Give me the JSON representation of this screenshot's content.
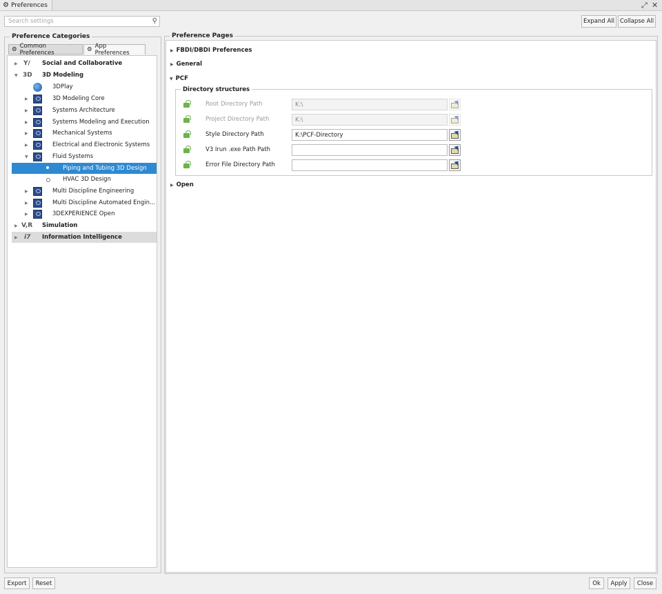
{
  "window": {
    "title": "Preferences"
  },
  "search": {
    "placeholder": "Search settings"
  },
  "toolbar": {
    "expand_all": "Expand All",
    "collapse_all": "Collapse All"
  },
  "categories": {
    "title": "Preference Categories",
    "tabs": [
      {
        "label": "Common Preferences"
      },
      {
        "label": "App Preferences"
      }
    ],
    "tree": [
      {
        "label": "Social and Collaborative",
        "icon_text": "Y/"
      },
      {
        "label": "3D Modeling",
        "icon_text": "3D"
      },
      {
        "label": "3DPlay"
      },
      {
        "label": "3D Modeling Core"
      },
      {
        "label": "Systems Architecture"
      },
      {
        "label": "Systems Modeling and Execution"
      },
      {
        "label": "Mechanical Systems"
      },
      {
        "label": "Electrical and Electronic Systems"
      },
      {
        "label": "Fluid Systems"
      },
      {
        "label": "Piping and Tubing 3D Design"
      },
      {
        "label": "HVAC 3D Design"
      },
      {
        "label": "Multi Discipline Engineering"
      },
      {
        "label": "Multi Discipline Automated Engin..."
      },
      {
        "label": "3DEXPERIENCE Open"
      },
      {
        "label": "Simulation",
        "icon_text": "V,R"
      },
      {
        "label": "Information Intelligence",
        "icon_text": "i7"
      }
    ]
  },
  "pages": {
    "title": "Preference Pages",
    "sections": [
      {
        "label": "FBDI/DBDI Preferences"
      },
      {
        "label": "General"
      },
      {
        "label": "PCF"
      },
      {
        "label": "Open"
      }
    ],
    "directory": {
      "title": "Directory structures",
      "fields": [
        {
          "label": "Root Directory Path",
          "value": "K:\\",
          "enabled": false
        },
        {
          "label": "Project Directory Path",
          "value": "K:\\",
          "enabled": false
        },
        {
          "label": "Style Directory Path",
          "value": "K:\\PCF-Directory",
          "enabled": true
        },
        {
          "label": "V3 Irun .exe Path Path",
          "value": "",
          "enabled": true
        },
        {
          "label": "Error File Directory Path",
          "value": "",
          "enabled": true
        }
      ]
    }
  },
  "footer": {
    "export": "Export",
    "reset": "Reset",
    "ok": "Ok",
    "apply": "Apply",
    "close": "Close"
  },
  "colors": {
    "selection": "#2d8ad2",
    "lock": "#6db34d",
    "app_icon": "#2c4c8a"
  }
}
